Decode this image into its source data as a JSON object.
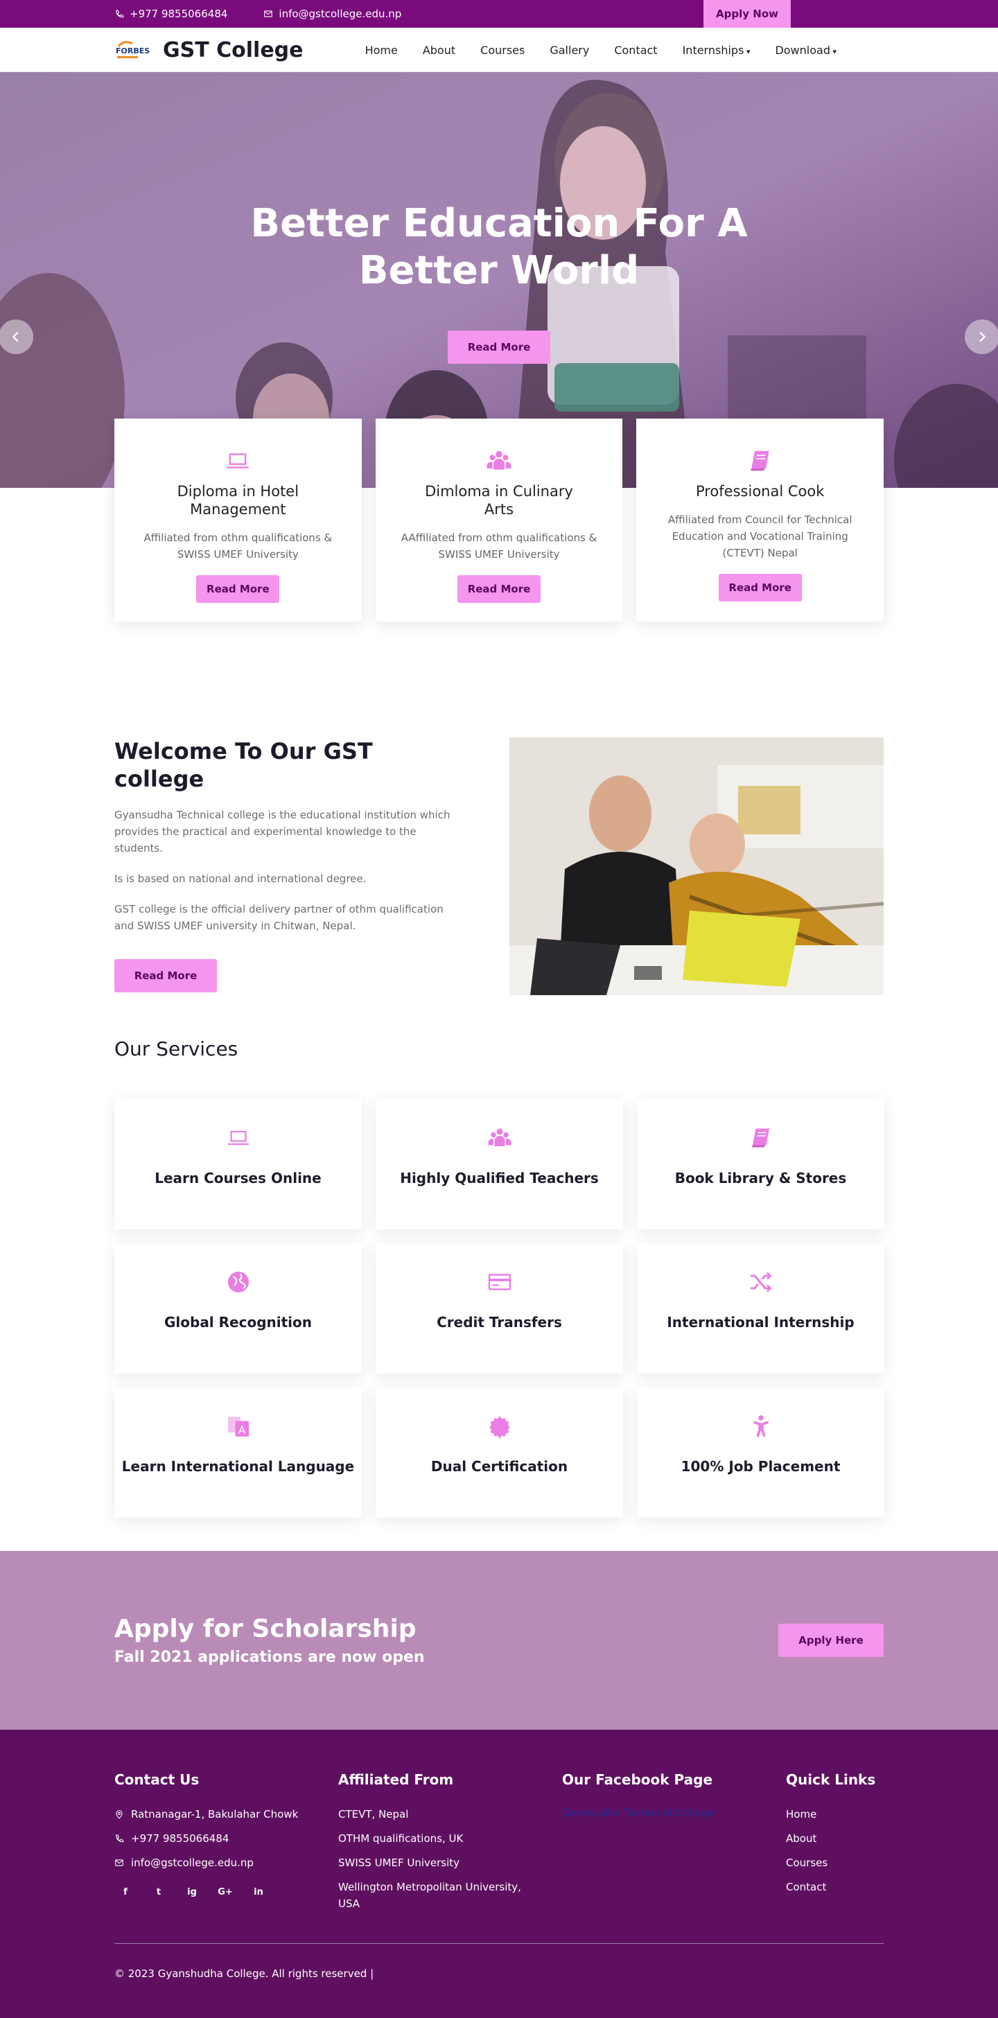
{
  "topbar": {
    "phone": "+977 9855066484",
    "email": "info@gstcollege.edu.np",
    "apply_label": "Apply Now"
  },
  "nav": {
    "brand": "GST College",
    "logo_text": "FORBES",
    "items": [
      "Home",
      "About",
      "Courses",
      "Gallery",
      "Contact",
      "Internships",
      "Download"
    ]
  },
  "hero": {
    "title": "Better Education For A Better World",
    "button": "Read More"
  },
  "features": [
    {
      "title": "Diploma in Hotel Management",
      "text": "Affiliated from othm qualifications & SWISS UMEF University",
      "button": "Read More",
      "icon": "laptop-icon"
    },
    {
      "title": "Dimloma in Culinary Arts",
      "text": "AAffiliated from othm qualifications & SWISS UMEF University",
      "button": "Read More",
      "icon": "users-icon"
    },
    {
      "title": "Professional Cook",
      "text": "Affiliated from Council for Technical Education and Vocational Training (CTEVT) Nepal",
      "button": "Read More",
      "icon": "book-icon"
    }
  ],
  "welcome": {
    "title": "Welcome To Our GST college",
    "p1": "Gyansudha Technical college is the educational institution which provides the practical and experimental knowledge to the students.",
    "p2": "Is is based on national and international degree.",
    "p3": "GST college is the official delivery partner of othm qualification and SWISS UMEF university in Chitwan, Nepal.",
    "button": "Read More"
  },
  "services": {
    "title": "Our Services",
    "items": [
      {
        "label": "Learn Courses Online",
        "icon": "laptop-icon"
      },
      {
        "label": "Highly Qualified Teachers",
        "icon": "users-icon"
      },
      {
        "label": "Book Library & Stores",
        "icon": "book-icon"
      },
      {
        "label": "Global Recognition",
        "icon": "globe-icon"
      },
      {
        "label": "Credit Transfers",
        "icon": "credit-card-icon"
      },
      {
        "label": "International Internship",
        "icon": "shuffle-icon"
      },
      {
        "label": "Learn International Language",
        "icon": "language-icon"
      },
      {
        "label": "Dual Certification",
        "icon": "certificate-icon"
      },
      {
        "label": "100% Job Placement",
        "icon": "person-icon"
      }
    ]
  },
  "scholarship": {
    "title": "Apply for Scholarship",
    "subtitle": "Fall 2021 applications are now open",
    "button": "Apply Here"
  },
  "footer": {
    "contact_title": "Contact Us",
    "address": "Ratnanagar-1, Bakulahar Chowk",
    "phone": "+977 9855066484",
    "email": "info@gstcollege.edu.np",
    "socials": [
      "f",
      "t",
      "ig",
      "G+",
      "in"
    ],
    "affiliated_title": "Affiliated From",
    "affiliated": [
      "CTEVT, Nepal",
      "OTHM qualifications, UK",
      "SWISS UMEF University",
      "Wellington Metropolitan University, USA"
    ],
    "facebook_title": "Our Facebook Page",
    "facebook_link": "Gyansudha Technical College",
    "links_title": "Quick Links",
    "links": [
      "Home",
      "About",
      "Courses",
      "Contact"
    ],
    "copyright": "© 2023 Gyanshudha College. All rights reserved |"
  },
  "colors": {
    "topbar": "#7a0b7c",
    "accent": "#f495ee",
    "button_text": "#5a0760",
    "scholarship_bg": "#b98bb7",
    "footer_bg": "#5f0f60"
  }
}
